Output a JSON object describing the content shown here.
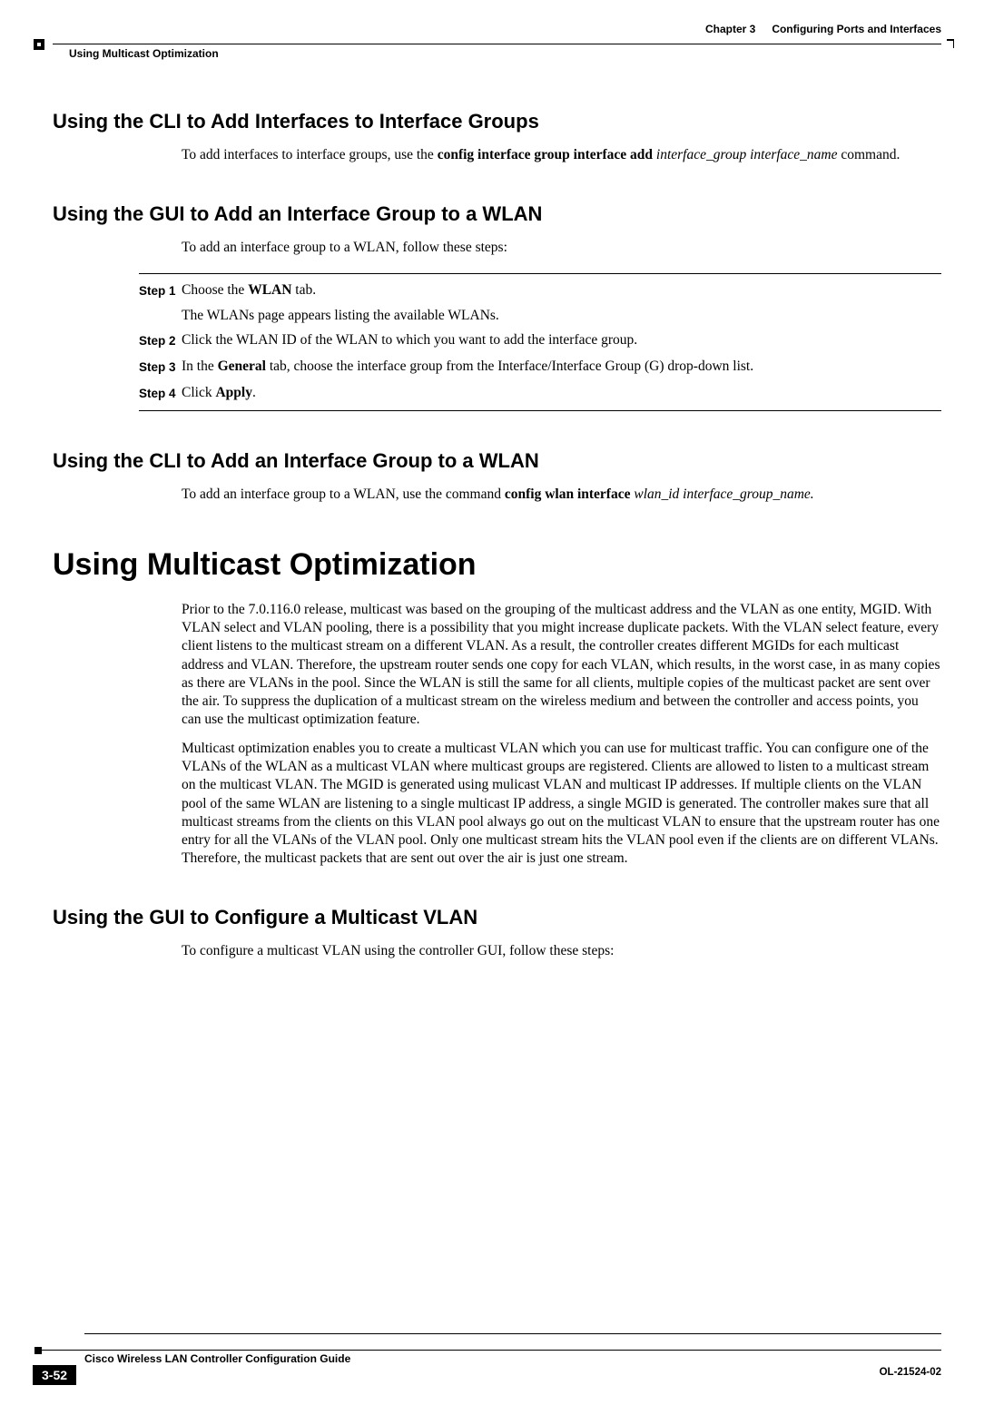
{
  "header": {
    "chapter_label": "Chapter 3",
    "chapter_title": "Configuring Ports and Interfaces",
    "section": "Using Multicast Optimization"
  },
  "sections": {
    "cli_add_interfaces": {
      "title": "Using the CLI to Add Interfaces to Interface Groups",
      "intro_prefix": "To add interfaces to interface groups, use the ",
      "command_bold": "config interface group interface add ",
      "command_italic": "interface_group interface_name",
      "suffix": " command."
    },
    "gui_add_group_wlan": {
      "title": "Using the GUI to Add an Interface Group to a WLAN",
      "intro": "To add an interface group to a WLAN, follow these steps:",
      "steps": [
        {
          "label": "Step 1",
          "text_prefix": "Choose the ",
          "text_bold": "WLAN",
          "text_suffix": " tab.",
          "sub": "The WLANs page appears listing the available WLANs."
        },
        {
          "label": "Step 2",
          "text": "Click the WLAN ID of the WLAN to which you want to add the interface group."
        },
        {
          "label": "Step 3",
          "text_prefix": "In the ",
          "text_bold": "General",
          "text_suffix": " tab, choose the interface group from the Interface/Interface Group (G) drop-down list."
        },
        {
          "label": "Step 4",
          "text_prefix": "Click ",
          "text_bold": "Apply",
          "text_suffix": "."
        }
      ]
    },
    "cli_add_group_wlan": {
      "title": "Using the CLI to Add an Interface Group to a WLAN",
      "intro_prefix": "To add an interface group to a WLAN, use the command ",
      "command_bold": "config wlan interface ",
      "command_italic": "wlan_id interface_group_name.",
      "suffix": ""
    },
    "multicast_opt": {
      "title": "Using Multicast Optimization",
      "para1": "Prior to the 7.0.116.0 release, multicast was based on the grouping of the multicast address and the VLAN as one entity, MGID. With VLAN select and VLAN pooling, there is a possibility that you might increase duplicate packets. With the VLAN select feature, every client listens to the multicast stream on a different VLAN. As a result, the controller creates different MGIDs for each multicast address and VLAN. Therefore, the upstream router sends one copy for each VLAN, which results, in the worst case, in as many copies as there are VLANs in the pool. Since the WLAN is still the same for all clients, multiple copies of the multicast packet are sent over the air. To suppress the duplication of a multicast stream on the wireless medium and between the controller and access points, you can use the multicast optimization feature.",
      "para2": "Multicast optimization enables you to create a multicast VLAN which you can use for multicast traffic. You can configure one of the VLANs of the WLAN as a multicast VLAN where multicast groups are registered. Clients are allowed to listen to a multicast stream on the multicast VLAN. The MGID is generated using mulicast VLAN and multicast IP addresses. If multiple clients on the VLAN pool of the same WLAN are listening to a single multicast IP address, a single MGID is generated. The controller makes sure that all multicast streams from the clients on this VLAN pool always go out on the multicast VLAN to ensure that the upstream router has one entry for all the VLANs of the VLAN pool. Only one multicast stream hits the VLAN pool even if the clients are on different VLANs. Therefore, the multicast packets that are sent out over the air is just one stream."
    },
    "gui_config_mvlan": {
      "title": "Using the GUI to Configure a Multicast VLAN",
      "intro": "To configure a multicast VLAN using the controller GUI, follow these steps:"
    }
  },
  "footer": {
    "guide_title": "Cisco Wireless LAN Controller Configuration Guide",
    "page_number": "3-52",
    "doc_num": "OL-21524-02"
  }
}
